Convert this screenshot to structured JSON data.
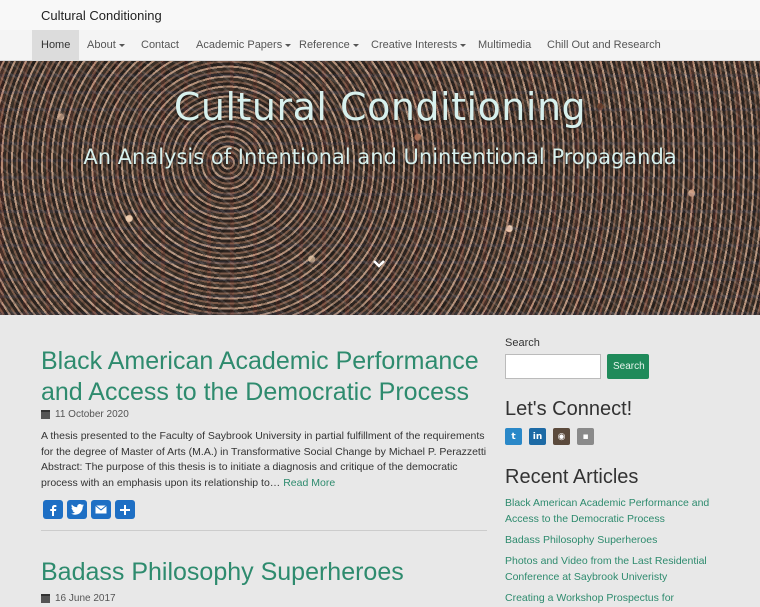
{
  "site": {
    "brand": "Cultural Conditioning"
  },
  "nav": {
    "items": [
      {
        "label": "Home",
        "dropdown": false,
        "active": true
      },
      {
        "label": "About",
        "dropdown": true
      },
      {
        "label": "Contact",
        "dropdown": false
      },
      {
        "label": "Academic Papers",
        "dropdown": true
      },
      {
        "label": "Reference",
        "dropdown": true
      },
      {
        "label": "Creative Interests",
        "dropdown": true
      },
      {
        "label": "Multimedia",
        "dropdown": false
      },
      {
        "label": "Chill Out and Research",
        "dropdown": false
      }
    ]
  },
  "hero": {
    "title": "Cultural Conditioning",
    "subtitle": "An Analysis of Intentional and Unintentional Propaganda"
  },
  "posts": [
    {
      "title": "Black American Academic Performance and Access to the Democratic Process",
      "date": "11 October 2020",
      "excerpt": "A thesis presented to the Faculty of Saybrook University in partial fulfillment of the requirements for the degree of Master of Arts (M.A.) in Transformative Social Change by Michael P. Perazzetti Abstract: The purpose of this thesis is to initiate a diagnosis and critique of the democratic process with an emphasis upon its relationship to…",
      "read_more": "Read More"
    },
    {
      "title": "Badass Philosophy Superheroes",
      "date": "16 June 2017"
    }
  ],
  "share": {
    "icons": [
      "facebook-icon",
      "twitter-icon",
      "email-icon",
      "share-icon"
    ],
    "color": "#1e6fc4"
  },
  "sidebar": {
    "search_label": "Search",
    "search_placeholder": "",
    "search_button": "Search",
    "connect_heading": "Let's Connect!",
    "social": [
      {
        "icon": "twitter-icon",
        "glyph": "t",
        "color": "#2a88c8"
      },
      {
        "icon": "linkedin-icon",
        "glyph": "in",
        "color": "#1d6aa5"
      },
      {
        "icon": "instagram-icon",
        "glyph": "◉",
        "color": "#5b4a3c"
      },
      {
        "icon": "blog-icon",
        "glyph": "▪",
        "color": "#8a8a8a"
      }
    ],
    "recent_heading": "Recent Articles",
    "recent": [
      "Black American Academic Performance and Access to the Democratic Process",
      "Badass Philosophy Superheroes",
      "Photos and Video from the Last Residential Conference at Saybrook Univeristy",
      "Creating a Workshop Prospectus for"
    ]
  },
  "colors": {
    "accent": "#2e8b6e",
    "search_button": "#1f8a5a"
  }
}
